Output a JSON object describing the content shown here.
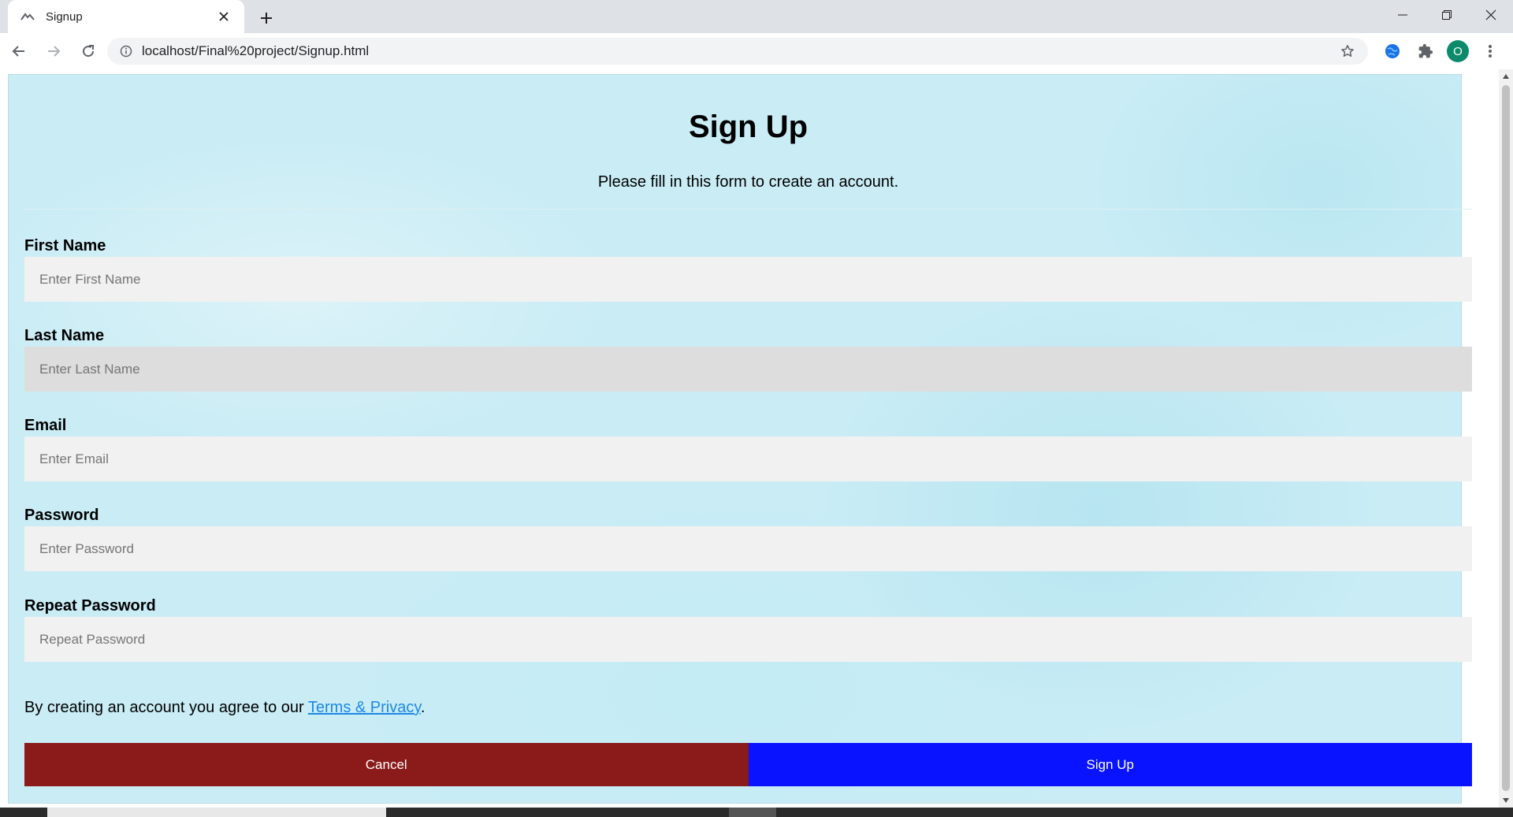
{
  "browser": {
    "tab_title": "Signup",
    "url": "localhost/Final%20project/Signup.html",
    "profile_initial": "O",
    "icons": [
      "favicon-icon",
      "close-icon",
      "plus-icon",
      "minimize-icon",
      "restore-icon",
      "close-window-icon",
      "back-icon",
      "forward-icon",
      "reload-icon",
      "info-icon",
      "star-icon",
      "globe-extension-icon",
      "puzzle-icon",
      "menu-dots-icon"
    ]
  },
  "form": {
    "title": "Sign Up",
    "subtitle": "Please fill in this form to create an account.",
    "fields": [
      {
        "label": "First Name",
        "placeholder": "Enter First Name",
        "value": ""
      },
      {
        "label": "Last Name",
        "placeholder": "Enter Last Name",
        "value": ""
      },
      {
        "label": "Email",
        "placeholder": "Enter Email",
        "value": ""
      },
      {
        "label": "Password",
        "placeholder": "Enter Password",
        "value": ""
      },
      {
        "label": "Repeat Password",
        "placeholder": "Repeat Password",
        "value": ""
      }
    ],
    "terms_prefix": "By creating an account you agree to our ",
    "terms_link": "Terms & Privacy",
    "terms_suffix": ".",
    "cancel_label": "Cancel",
    "signup_label": "Sign Up"
  },
  "colors": {
    "cancel": "#8b1a1a",
    "signup": "#0a13ff",
    "background": "#c9ecf5",
    "link": "#1e88e5"
  }
}
